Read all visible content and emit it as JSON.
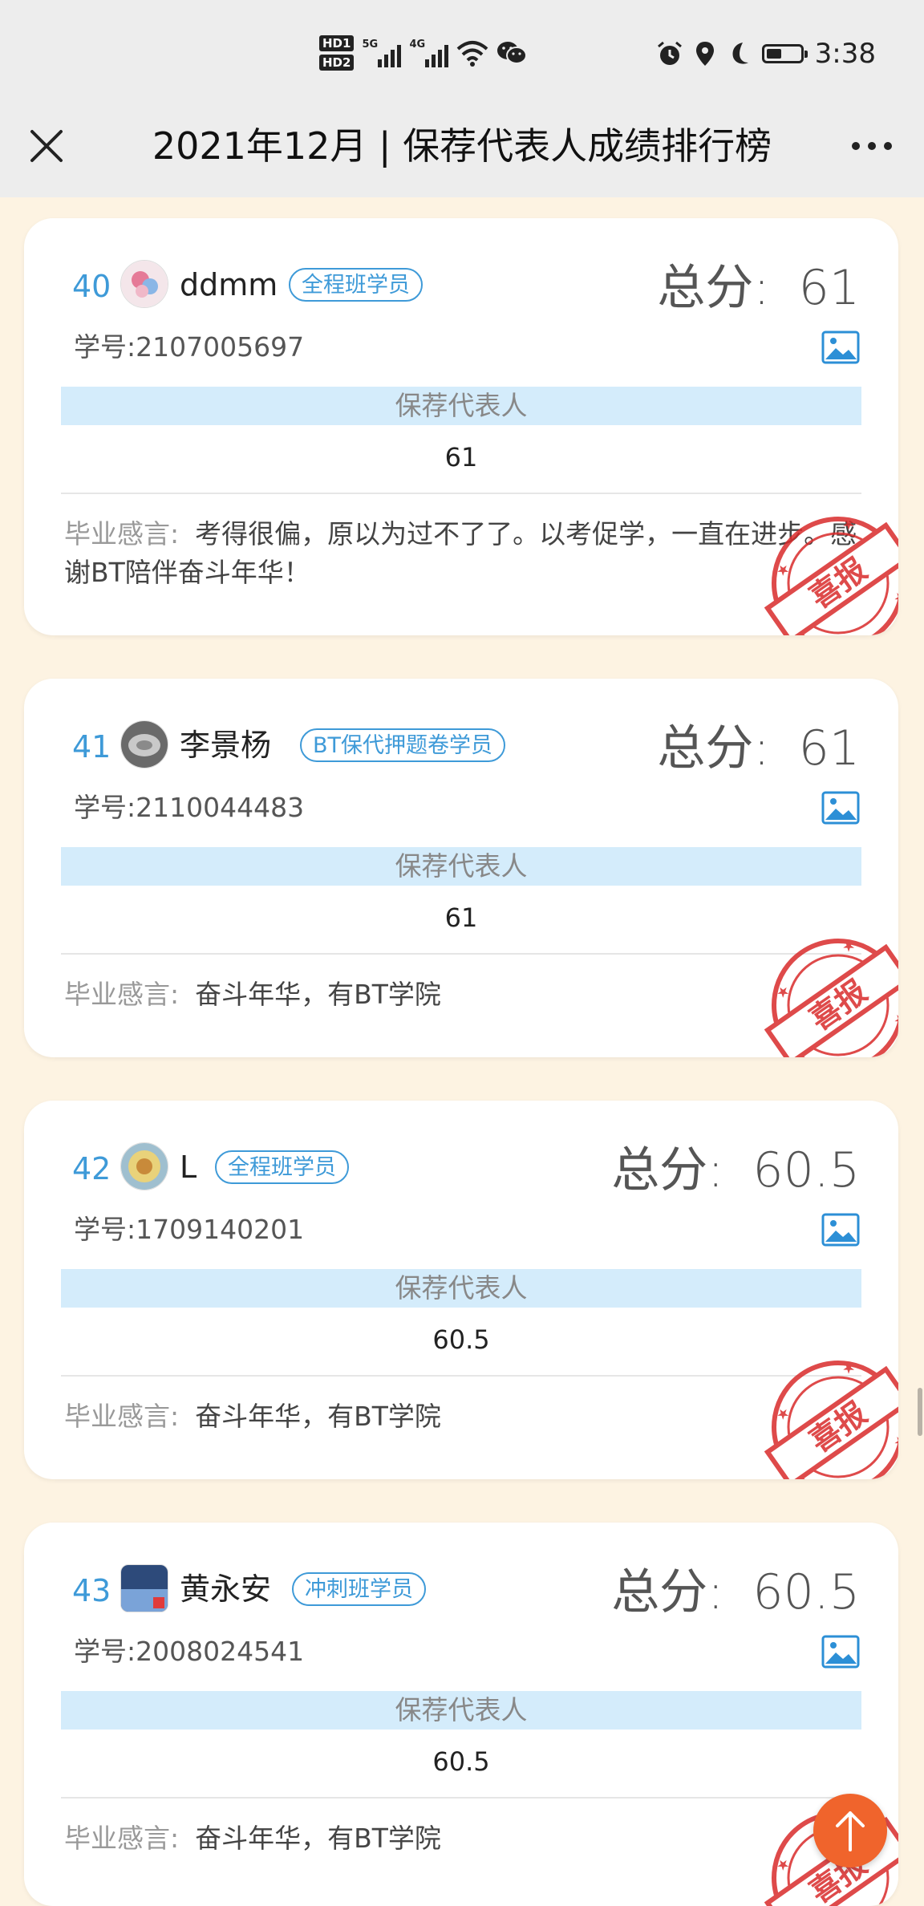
{
  "status_bar": {
    "hd1": "HD1",
    "hd2": "HD2",
    "net1": "5G",
    "net2": "4G",
    "time": "3:38",
    "battery_level": 0.45
  },
  "nav": {
    "title": "2021年12月 | 保荐代表人成绩排行榜"
  },
  "labels": {
    "score_label": "总分:",
    "id_label": "学号:",
    "speech_label": "毕业感言:"
  },
  "cards": [
    {
      "rank": "40",
      "name": "ddmm",
      "tag": "全程班学员",
      "score": "61",
      "student_id": "2107005697",
      "subject": "保荐代表人",
      "subject_score": "61",
      "speech": "考得很偏，原以为过不了了。以考促学，一直在进步。感谢BT陪伴奋斗年华！",
      "stamp_text": "喜报"
    },
    {
      "rank": "41",
      "name": "李景杨",
      "tag": "BT保代押题卷学员",
      "score": "61",
      "student_id": "2110044483",
      "subject": "保荐代表人",
      "subject_score": "61",
      "speech": "奋斗年华，有BT学院",
      "stamp_text": "喜报"
    },
    {
      "rank": "42",
      "name": "L",
      "tag": "全程班学员",
      "score": "60.5",
      "student_id": "1709140201",
      "subject": "保荐代表人",
      "subject_score": "60.5",
      "speech": "奋斗年华，有BT学院",
      "stamp_text": "喜报"
    },
    {
      "rank": "43",
      "name": "黄永安",
      "tag": "冲刺班学员",
      "score": "60.5",
      "student_id": "2008024541",
      "subject": "保荐代表人",
      "subject_score": "60.5",
      "speech": "奋斗年华，有BT学院",
      "stamp_text": "喜报"
    }
  ],
  "colors": {
    "accent": "#3e9ad8",
    "bar_bg": "#d4ecfb",
    "stamp": "#d92b2b",
    "back_to_top": "#f0642c",
    "page_bg": "#fdf3e2"
  }
}
